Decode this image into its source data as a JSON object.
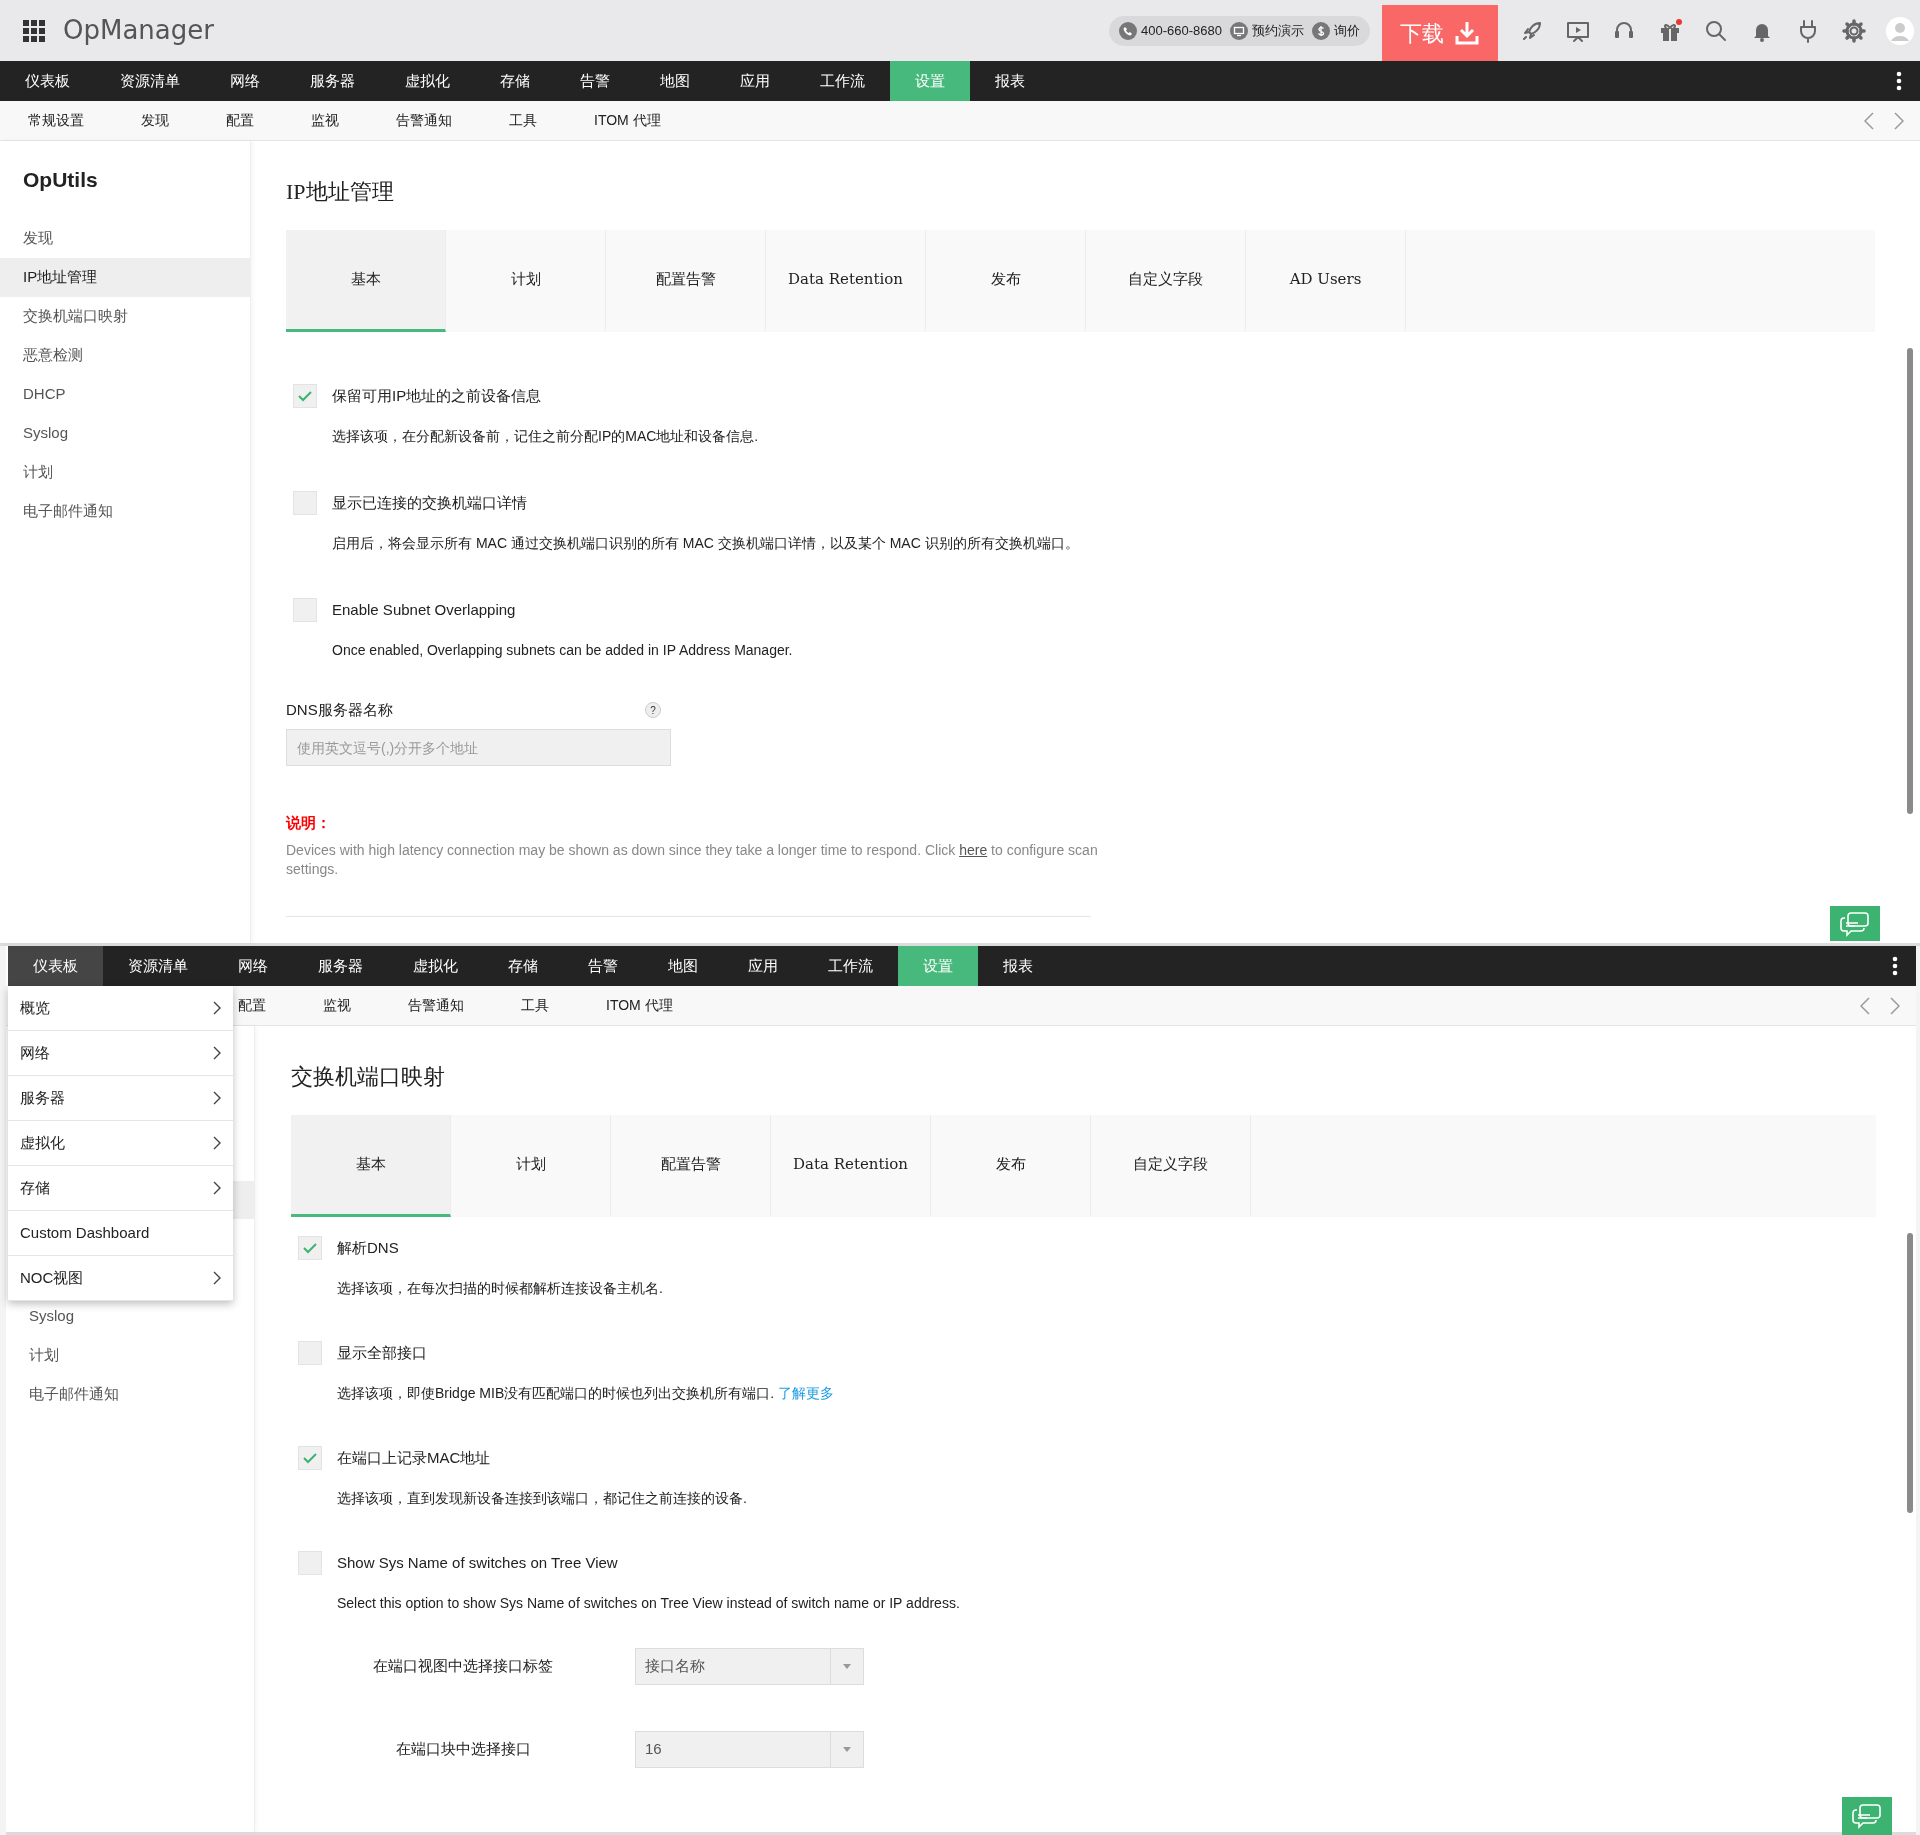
{
  "header": {
    "app_name": "OpManager",
    "phone": "400-660-8680",
    "demo": "预约演示",
    "quote": "询价",
    "download": "下载"
  },
  "screens": [
    {
      "nav": [
        {
          "label": "仪表板",
          "selected": false
        },
        {
          "label": "资源清单",
          "selected": false
        },
        {
          "label": "网络",
          "selected": false
        },
        {
          "label": "服务器",
          "selected": false
        },
        {
          "label": "虚拟化",
          "selected": false
        },
        {
          "label": "存储",
          "selected": false
        },
        {
          "label": "告警",
          "selected": false
        },
        {
          "label": "地图",
          "selected": false
        },
        {
          "label": "应用",
          "selected": false
        },
        {
          "label": "工作流",
          "selected": false
        },
        {
          "label": "设置",
          "selected": true
        },
        {
          "label": "报表",
          "selected": false
        }
      ],
      "subnav": [
        "常规设置",
        "发现",
        "配置",
        "监视",
        "告警通知",
        "工具",
        "ITOM 代理"
      ],
      "sidebar": {
        "title": "OpUtils",
        "items": [
          {
            "label": "发现",
            "selected": false
          },
          {
            "label": "IP地址管理",
            "selected": true
          },
          {
            "label": "交换机端口映射",
            "selected": false
          },
          {
            "label": "恶意检测",
            "selected": false
          },
          {
            "label": "DHCP",
            "selected": false
          },
          {
            "label": "Syslog",
            "selected": false
          },
          {
            "label": "计划",
            "selected": false
          },
          {
            "label": "电子邮件通知",
            "selected": false
          }
        ]
      },
      "page": {
        "title": "IP地址管理",
        "tabs": [
          {
            "label": "基本",
            "selected": true
          },
          {
            "label": "计划",
            "selected": false
          },
          {
            "label": "配置告警",
            "selected": false
          },
          {
            "label": "Data Retention",
            "selected": false
          },
          {
            "label": "发布",
            "selected": false
          },
          {
            "label": "自定义字段",
            "selected": false
          },
          {
            "label": "AD Users",
            "selected": false
          }
        ],
        "options": [
          {
            "label": "保留可用IP地址的之前设备信息",
            "description": "选择该项，在分配新设备前，记住之前分配IP的MAC地址和设备信息.",
            "checked": true
          },
          {
            "label": "显示已连接的交换机端口详情",
            "description": "启用后，将会显示所有 MAC 通过交换机端口识别的所有 MAC 交换机端口详情，以及某个 MAC 识别的所有交换机端口。",
            "checked": false
          },
          {
            "label": "Enable Subnet Overlapping",
            "description": "Once enabled, Overlapping subnets can be added in IP Address Manager.",
            "checked": false
          }
        ],
        "dns": {
          "label": "DNS服务器名称",
          "help": "?",
          "placeholder": "使用英文逗号(,)分开多个地址"
        },
        "note": {
          "label": "说明：",
          "text": "Devices with high latency connection may be shown as down since they take a longer time to respond. Click ",
          "link": "here",
          "text_end": " to configure scan settings."
        }
      }
    },
    {
      "nav": [
        {
          "label": "仪表板",
          "selected": false,
          "hovered": true
        },
        {
          "label": "资源清单",
          "selected": false,
          "hovered": false
        },
        {
          "label": "网络",
          "selected": false,
          "hovered": false
        },
        {
          "label": "服务器",
          "selected": false,
          "hovered": false
        },
        {
          "label": "虚拟化",
          "selected": false,
          "hovered": false
        },
        {
          "label": "存储",
          "selected": false,
          "hovered": false
        },
        {
          "label": "告警",
          "selected": false,
          "hovered": false
        },
        {
          "label": "地图",
          "selected": false,
          "hovered": false
        },
        {
          "label": "应用",
          "selected": false,
          "hovered": false
        },
        {
          "label": "工作流",
          "selected": false,
          "hovered": false
        },
        {
          "label": "设置",
          "selected": true,
          "hovered": false
        },
        {
          "label": "报表",
          "selected": false,
          "hovered": false
        }
      ],
      "subnav": [
        "配置",
        "监视",
        "告警通知",
        "工具",
        "ITOM 代理"
      ],
      "menu": [
        {
          "label": "概览",
          "submenu": true
        },
        {
          "label": "网络",
          "submenu": true
        },
        {
          "label": "服务器",
          "submenu": true
        },
        {
          "label": "虚拟化",
          "submenu": true
        },
        {
          "label": "存储",
          "submenu": true
        },
        {
          "label": "Custom Dashboard",
          "submenu": false
        },
        {
          "label": "NOC视图",
          "submenu": true
        }
      ],
      "sidebar": {
        "items": [
          {
            "label": "Syslog",
            "selected": false
          },
          {
            "label": "计划",
            "selected": false
          },
          {
            "label": "电子邮件通知",
            "selected": false
          }
        ]
      },
      "page": {
        "title": "交换机端口映射",
        "tabs": [
          {
            "label": "基本",
            "selected": true
          },
          {
            "label": "计划",
            "selected": false
          },
          {
            "label": "配置告警",
            "selected": false
          },
          {
            "label": "Data Retention",
            "selected": false
          },
          {
            "label": "发布",
            "selected": false
          },
          {
            "label": "自定义字段",
            "selected": false
          }
        ],
        "options": [
          {
            "label": "解析DNS",
            "description": "选择该项，在每次扫描的时候都解析连接设备主机名.",
            "checked": true
          },
          {
            "label": "显示全部接口",
            "description": "选择该项，即使Bridge MIB没有匹配端口的时候也列出交换机所有端口.",
            "link": "了解更多",
            "checked": false
          },
          {
            "label": "在端口上记录MAC地址",
            "description": "选择该项，直到发现新设备连接到该端口，都记住之前连接的设备.",
            "checked": true
          },
          {
            "label": "Show Sys Name of switches on Tree View",
            "description": "Select this option to show Sys Name of switches on Tree View instead of switch name or IP address.",
            "checked": false
          }
        ],
        "selects": [
          {
            "label": "在端口视图中选择接口标签",
            "value": "接口名称"
          },
          {
            "label": "在端口块中选择接口",
            "value": "16"
          }
        ]
      }
    }
  ]
}
